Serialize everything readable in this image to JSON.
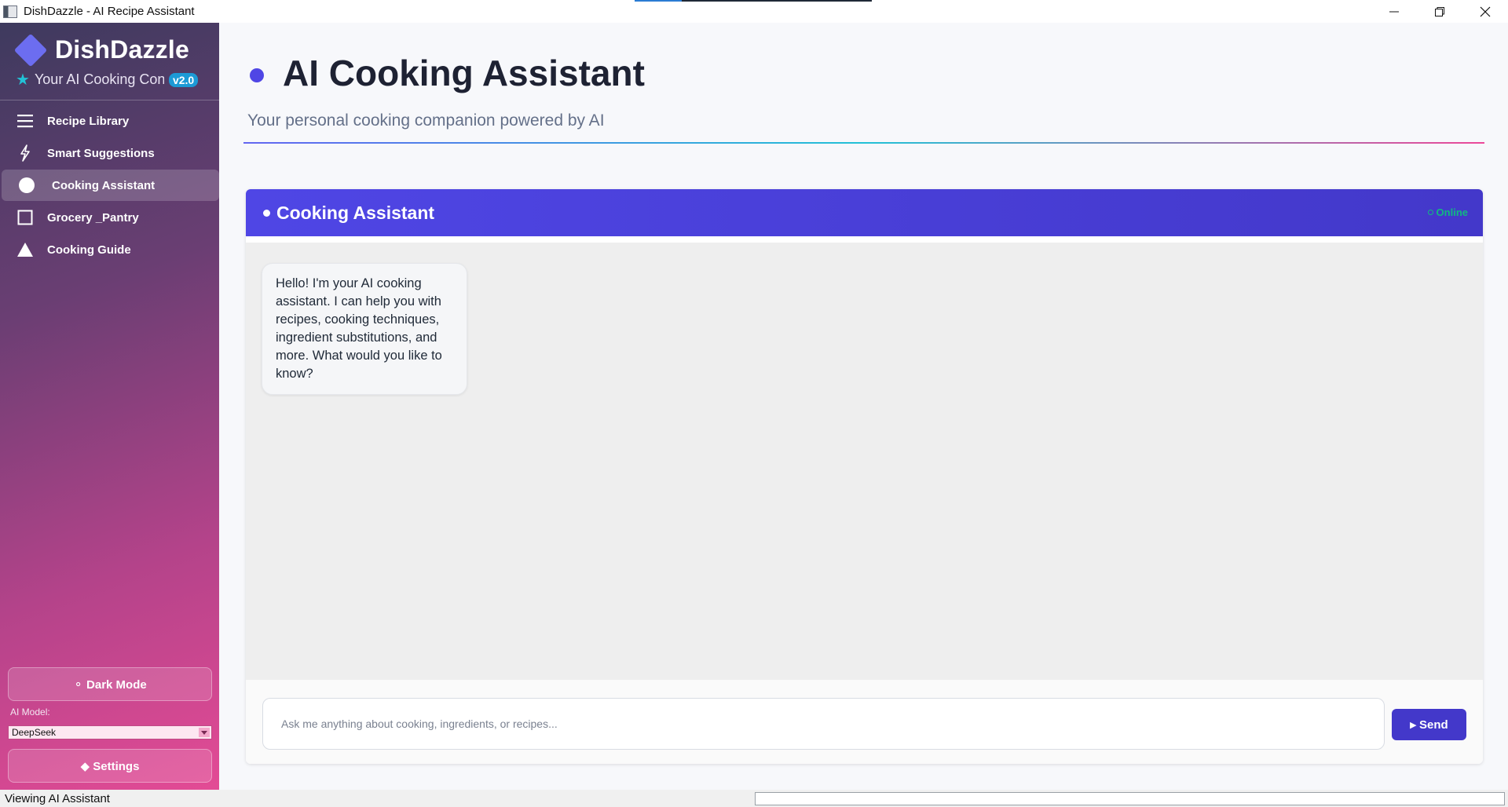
{
  "window": {
    "title": "DishDazzle - AI Recipe Assistant",
    "controls": [
      "minimize",
      "restore",
      "close"
    ]
  },
  "sidebar": {
    "brand_name": "DishDazzle",
    "tagline": "Your AI Cooking Con",
    "version": "v2.0",
    "items": [
      {
        "label": "Recipe Library",
        "icon": "menu-icon"
      },
      {
        "label": "Smart Suggestions",
        "icon": "lightning-icon"
      },
      {
        "label": "Cooking Assistant",
        "icon": "circle-icon",
        "active": true
      },
      {
        "label": "Grocery _Pantry",
        "icon": "square-icon"
      },
      {
        "label": "Cooking Guide",
        "icon": "triangle-icon"
      }
    ],
    "dark_mode_label": "⚬ Dark Mode",
    "ai_model_label": "AI Model:",
    "ai_model_value": "DeepSeek",
    "settings_label": "◆ Settings"
  },
  "main": {
    "title": "AI Cooking Assistant",
    "subtitle": "Your personal cooking companion powered by AI"
  },
  "chat": {
    "title": "Cooking Assistant",
    "status": "Online",
    "messages": [
      {
        "sender": "assistant",
        "text": "Hello! I'm your AI cooking assistant. I can help you with recipes, cooking techniques, ingredient substitutions, and more. What would you like to know?"
      }
    ],
    "input_placeholder": "Ask me anything about cooking, ingredients, or recipes...",
    "send_label": "▸ Send"
  },
  "statusbar": {
    "text": "Viewing AI Assistant"
  },
  "colors": {
    "accent": "#4f46e5",
    "online": "#10b981",
    "sidebar_start": "#3e3a5e",
    "sidebar_end": "#e34b95"
  }
}
